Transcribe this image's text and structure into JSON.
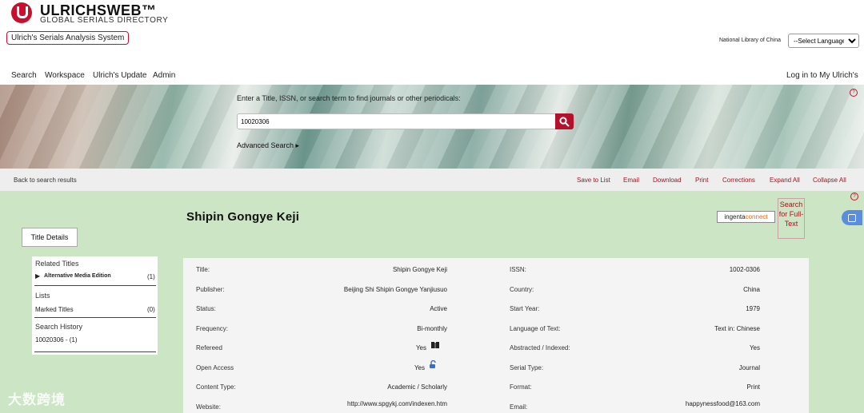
{
  "brand": {
    "name": "ULRICHSWEB™",
    "subtitle": "GLOBAL SERIALS DIRECTORY",
    "system_badge": "Ulrich's Serials Analysis System"
  },
  "header": {
    "library": "National Library of China",
    "language_select": "--Select Language--"
  },
  "nav": {
    "items": [
      "Search",
      "Workspace",
      "Ulrich's Update",
      "Admin"
    ],
    "login": "Log in to My Ulrich's"
  },
  "search": {
    "prompt": "Enter a Title, ISSN, or search term to find journals or other periodicals:",
    "value": "10020306",
    "advanced": "Advanced Search ▸"
  },
  "toolbar": {
    "back": "Back to search results",
    "actions": [
      "Save to List",
      "Email",
      "Download",
      "Print",
      "Corrections",
      "Expand All",
      "Collapse All"
    ]
  },
  "tab": {
    "title_details": "Title Details"
  },
  "sidebar": {
    "related_titles": "Related Titles",
    "alt_media_label": "Alternative Media Edition",
    "alt_media_count": "(1)",
    "lists": "Lists",
    "marked_titles": "Marked Titles",
    "marked_count": "(0)",
    "history": "Search History",
    "history_item": "10020306 - (1)"
  },
  "journal": {
    "title": "Shipin Gongye Keji",
    "ingenta_a": "ingenta",
    "ingenta_b": "connect",
    "fulltext": "Search for Full-Text"
  },
  "details": {
    "left": [
      {
        "label": "Title:",
        "value": "Shipin Gongye Keji"
      },
      {
        "label": "Publisher:",
        "value": "Beijing Shi Shipin Gongye Yanjiusuo"
      },
      {
        "label": "Status:",
        "value": "Active"
      },
      {
        "label": "Frequency:",
        "value": "Bi-monthly"
      },
      {
        "label": "Refereed",
        "value": "Yes"
      },
      {
        "label": "Open Access",
        "value": "Yes"
      },
      {
        "label": "Content Type:",
        "value": "Academic / Scholarly"
      },
      {
        "label": "Website:",
        "value": "http://www.spgykj.com/indexen.htm"
      }
    ],
    "right": [
      {
        "label": "ISSN:",
        "value": "1002-0306"
      },
      {
        "label": "Country:",
        "value": "China"
      },
      {
        "label": "Start Year:",
        "value": "1979"
      },
      {
        "label": "Language of Text:",
        "value": "Text in: Chinese"
      },
      {
        "label": "Abstracted / Indexed:",
        "value": "Yes"
      },
      {
        "label": "Serial Type:",
        "value": "Journal"
      },
      {
        "label": "Format:",
        "value": "Print"
      },
      {
        "label": "Email:",
        "value": "happynessfood@163.com"
      }
    ]
  },
  "watermark": "大数跨境"
}
